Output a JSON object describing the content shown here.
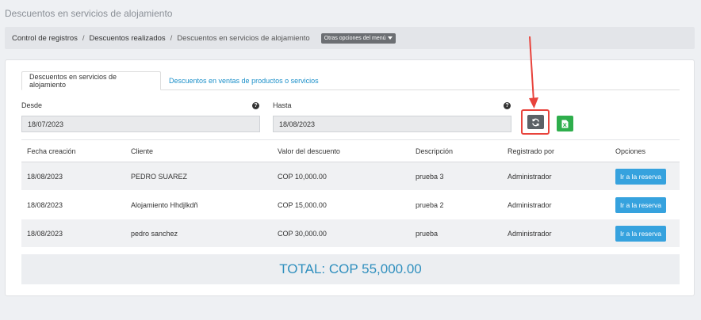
{
  "page": {
    "title": "Descuentos en servicios de alojamiento"
  },
  "breadcrumb": {
    "items": [
      "Control de registros",
      "Descuentos realizados",
      "Descuentos en servicios de alojamiento"
    ],
    "menu_button": "Otras opciones del menú"
  },
  "tabs": [
    {
      "label": "Descuentos en servicios de alojamiento",
      "active": true
    },
    {
      "label": "Descuentos en ventas de productos o servicios",
      "active": false
    }
  ],
  "filters": {
    "desde": {
      "label": "Desde",
      "value": "18/07/2023",
      "help": "?"
    },
    "hasta": {
      "label": "Hasta",
      "value": "18/08/2023",
      "help": "?"
    }
  },
  "icons": {
    "refresh": "refresh-icon",
    "excel": "excel-icon",
    "help": "question-circle-icon",
    "caret": "caret-down-icon"
  },
  "colors": {
    "accent": "#36a2de",
    "highlight": "#e8433c",
    "excel": "#2eae4c",
    "total": "#2f8fbe"
  },
  "table": {
    "columns": [
      "Fecha creación",
      "Cliente",
      "Valor del descuento",
      "Descripción",
      "Registrado por",
      "Opciones"
    ],
    "rows": [
      {
        "fecha": "18/08/2023",
        "cliente": "PEDRO SUAREZ",
        "valor": "COP 10,000.00",
        "descripcion": "prueba 3",
        "registrado": "Administrador",
        "opcion": "Ir a la reserva"
      },
      {
        "fecha": "18/08/2023",
        "cliente": "Alojamiento Hhdjlkdñ",
        "valor": "COP 15,000.00",
        "descripcion": "prueba 2",
        "registrado": "Administrador",
        "opcion": "Ir a la reserva"
      },
      {
        "fecha": "18/08/2023",
        "cliente": "pedro sanchez",
        "valor": "COP 30,000.00",
        "descripcion": "prueba",
        "registrado": "Administrador",
        "opcion": "Ir a la reserva"
      }
    ]
  },
  "total": {
    "text": "TOTAL: COP 55,000.00"
  }
}
